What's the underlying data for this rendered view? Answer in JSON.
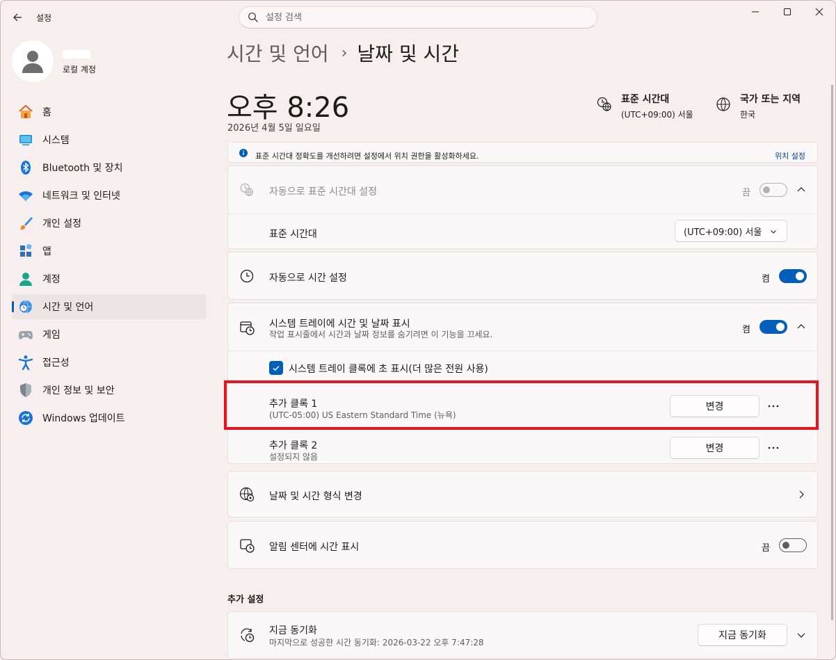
{
  "window": {
    "title": "설정"
  },
  "search": {
    "placeholder": "설정 검색"
  },
  "profile": {
    "subtitle": "로컬 계정"
  },
  "sidebar": {
    "items": [
      {
        "label": "홈",
        "icon": "home-icon"
      },
      {
        "label": "시스템",
        "icon": "system-icon"
      },
      {
        "label": "Bluetooth 및 장치",
        "icon": "bluetooth-icon"
      },
      {
        "label": "네트워크 및 인터넷",
        "icon": "wifi-icon"
      },
      {
        "label": "개인 설정",
        "icon": "brush-icon"
      },
      {
        "label": "앱",
        "icon": "apps-icon"
      },
      {
        "label": "계정",
        "icon": "account-icon"
      },
      {
        "label": "시간 및 언어",
        "icon": "time-language-icon",
        "active": true
      },
      {
        "label": "게임",
        "icon": "gamepad-icon"
      },
      {
        "label": "접근성",
        "icon": "accessibility-icon"
      },
      {
        "label": "개인 정보 및 보안",
        "icon": "shield-icon"
      },
      {
        "label": "Windows 업데이트",
        "icon": "update-icon"
      }
    ]
  },
  "breadcrumb": {
    "parent": "시간 및 언어",
    "separator": "›",
    "current": "날짜 및 시간"
  },
  "clock": {
    "time": "오후 8:26",
    "date": "2026년 4월 5일 일요일"
  },
  "timezone_info": {
    "title": "표준 시간대",
    "value": "(UTC+09:00) 서울"
  },
  "region_info": {
    "title": "국가 또는 지역",
    "value": "한국"
  },
  "banner": {
    "text": "표준 시간대 정확도를 개선하려면 설정에서 위치 권한을 활성화하세요.",
    "link": "위치 설정"
  },
  "auto_timezone": {
    "title": "자동으로 표준 시간대 설정",
    "state_label": "끔",
    "enabled": false,
    "disabled": true
  },
  "timezone": {
    "title": "표준 시간대",
    "selected": "(UTC+09:00) 서울"
  },
  "auto_time": {
    "title": "자동으로 시간 설정",
    "state_label": "켬",
    "enabled": true
  },
  "tray": {
    "title": "시스템 트레이에 시간 및 날짜 표시",
    "subtitle": "작업 표시줄에서 시간과 날짜 정보를 숨기려면 이 기능을 끄세요.",
    "state_label": "켬",
    "enabled": true,
    "seconds_label": "시스템 트레이 클록에 초 표시(더 많은 전원 사용)",
    "seconds_checked": true
  },
  "clock1": {
    "title": "추가 클록 1",
    "subtitle": "(UTC-05:00) US Eastern Standard Time (뉴욕)",
    "button": "변경"
  },
  "clock2": {
    "title": "추가 클록 2",
    "subtitle": "설정되지 않음",
    "button": "변경"
  },
  "format": {
    "title": "날짜 및 시간 형식 변경"
  },
  "notification_time": {
    "title": "알림 센터에 시간 표시",
    "state_label": "끔",
    "enabled": false
  },
  "additional": {
    "section_title": "추가 설정"
  },
  "sync": {
    "title": "지금 동기화",
    "subtitle": "마지막으로 성공한 시간 동기화: 2026-03-22 오후 7:47:28",
    "button": "지금 동기화"
  },
  "colors": {
    "accent": "#005fb8",
    "highlight": "#e8141e"
  }
}
